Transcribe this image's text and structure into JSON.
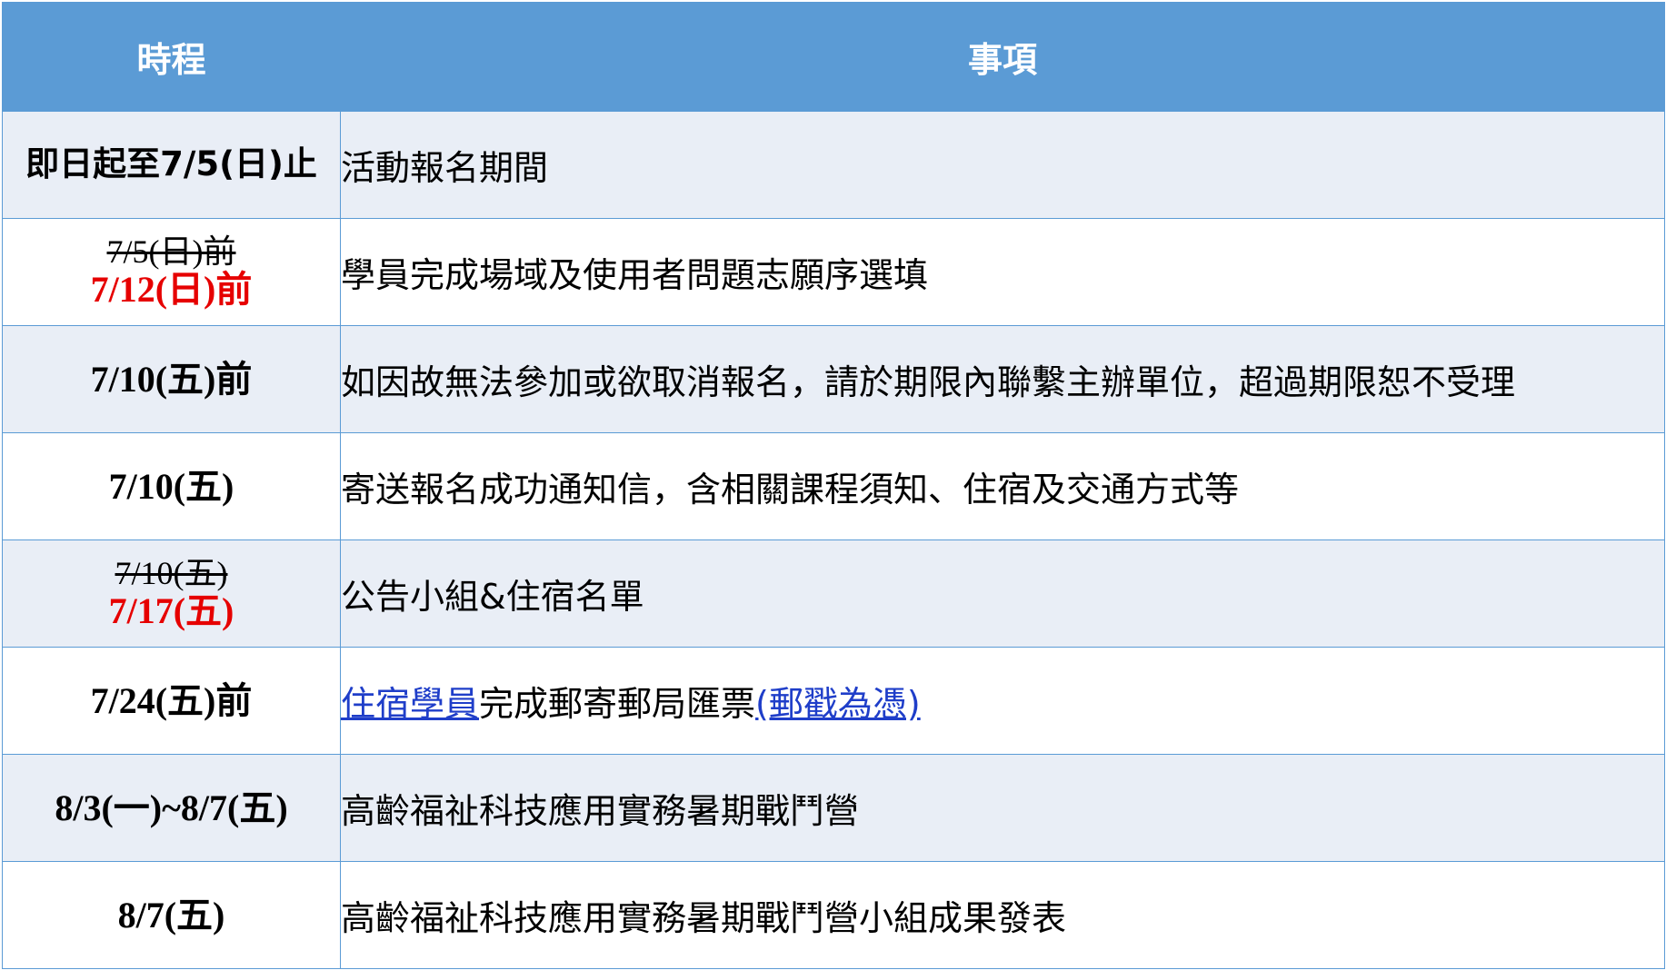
{
  "header": {
    "col_time": "時程",
    "col_item": "事項"
  },
  "rows": [
    {
      "time": "即日起至7/5(日)止",
      "item": "活動報名期間"
    },
    {
      "time_old": "7/5(日)前",
      "time_new": "7/12(日)前",
      "item": "學員完成場域及使用者問題志願序選填"
    },
    {
      "time": "7/10(五)前",
      "item": "如因故無法參加或欲取消報名，請於期限內聯繫主辦單位，超過期限恕不受理"
    },
    {
      "time": "7/10(五)",
      "item": "寄送報名成功通知信，含相關課程須知、住宿及交通方式等"
    },
    {
      "time_old": "7/10(五)",
      "time_new": "7/17(五)",
      "item": "公告小組&住宿名單"
    },
    {
      "time": "7/24(五)前",
      "item_link1": "住宿學員",
      "item_mid": "完成郵寄郵局匯票",
      "item_link2": "(郵戳為憑)"
    },
    {
      "time": "8/3(一)~8/7(五)",
      "item": "高齡福祉科技應用實務暑期戰鬥營"
    },
    {
      "time": "8/7(五)",
      "item": "高齡福祉科技應用實務暑期戰鬥營小組成果發表"
    }
  ],
  "colors": {
    "header_bg": "#5b9bd5",
    "shade_bg": "#e9eef6",
    "updated_date": "#e60000",
    "link": "#1f3ec9"
  }
}
